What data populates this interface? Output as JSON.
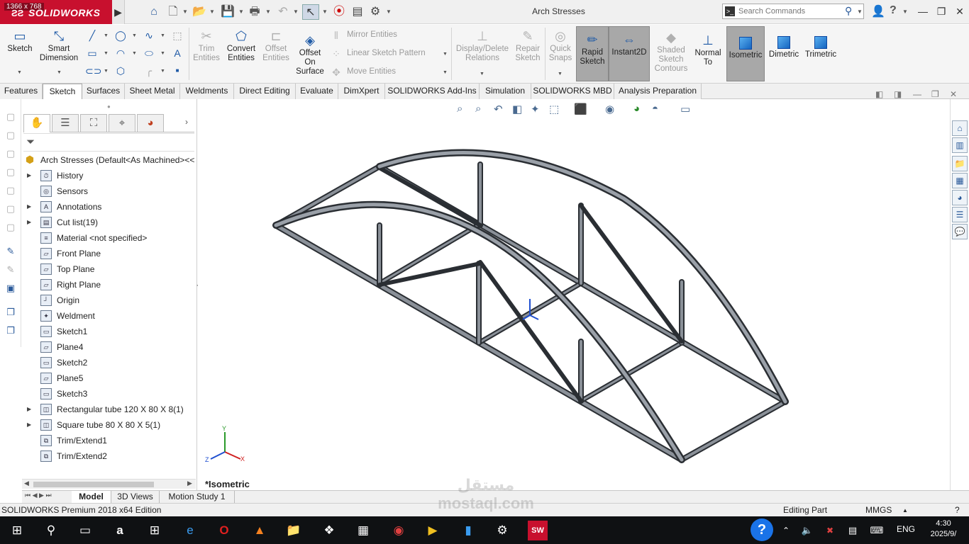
{
  "window": {
    "resolution_badge": "1366 x 768",
    "brand": "SOLIDWORKS",
    "title": "Arch Stresses",
    "search_placeholder": "Search Commands"
  },
  "ribbon": {
    "sketch": "Sketch",
    "smart_dimension": "Smart Dimension",
    "trim_entities": "Trim Entities",
    "convert_entities": "Convert Entities",
    "offset_entities": "Offset Entities",
    "offset_on_surface": "Offset On Surface",
    "mirror_entities": "Mirror Entities",
    "linear_sketch_pattern": "Linear Sketch Pattern",
    "move_entities": "Move Entities",
    "display_delete_relations": "Display/Delete Relations",
    "repair_sketch": "Repair Sketch",
    "quick_snaps": "Quick Snaps",
    "rapid_sketch": "Rapid Sketch",
    "instant2d": "Instant2D",
    "shaded_sketch_contours": "Shaded Sketch Contours",
    "normal_to": "Normal To",
    "isometric": "Isometric",
    "dimetric": "Dimetric",
    "trimetric": "Trimetric"
  },
  "tabs": [
    "Features",
    "Sketch",
    "Surfaces",
    "Sheet Metal",
    "Weldments",
    "Direct Editing",
    "Evaluate",
    "DimXpert",
    "SOLIDWORKS Add-Ins",
    "Simulation",
    "SOLIDWORKS MBD",
    "Analysis Preparation"
  ],
  "feature_tree": {
    "root": "Arch Stresses  (Default<As Machined><<",
    "items": [
      {
        "label": "History",
        "expandable": true,
        "icon": "history-icon"
      },
      {
        "label": "Sensors",
        "expandable": false,
        "icon": "sensor-icon"
      },
      {
        "label": "Annotations",
        "expandable": true,
        "icon": "annotation-icon"
      },
      {
        "label": "Cut list(19)",
        "expandable": true,
        "icon": "cutlist-icon"
      },
      {
        "label": "Material <not specified>",
        "expandable": false,
        "icon": "material-icon"
      },
      {
        "label": "Front Plane",
        "expandable": false,
        "icon": "plane-icon"
      },
      {
        "label": "Top Plane",
        "expandable": false,
        "icon": "plane-icon"
      },
      {
        "label": "Right Plane",
        "expandable": false,
        "icon": "plane-icon"
      },
      {
        "label": "Origin",
        "expandable": false,
        "icon": "origin-icon"
      },
      {
        "label": "Weldment",
        "expandable": false,
        "icon": "weldment-icon"
      },
      {
        "label": "Sketch1",
        "expandable": false,
        "icon": "sketch-icon"
      },
      {
        "label": "Plane4",
        "expandable": false,
        "icon": "plane-icon"
      },
      {
        "label": "Sketch2",
        "expandable": false,
        "icon": "sketch-icon"
      },
      {
        "label": "Plane5",
        "expandable": false,
        "icon": "plane-icon"
      },
      {
        "label": "Sketch3",
        "expandable": false,
        "icon": "sketch-icon"
      },
      {
        "label": "Rectangular tube 120 X 80 X 8(1)",
        "expandable": true,
        "icon": "structural-member-icon"
      },
      {
        "label": "Square tube 80 X 80 X 5(1)",
        "expandable": true,
        "icon": "structural-member-icon"
      },
      {
        "label": "Trim/Extend1",
        "expandable": false,
        "icon": "trim-extend-icon"
      },
      {
        "label": "Trim/Extend2",
        "expandable": false,
        "icon": "trim-extend-icon"
      }
    ]
  },
  "viewport": {
    "view_label": "*Isometric",
    "triad": {
      "x": "X",
      "y": "Y",
      "z": "Z"
    }
  },
  "model_tabs": [
    "Model",
    "3D Views",
    "Motion Study 1"
  ],
  "status": {
    "edition": "SOLIDWORKS Premium 2018 x64 Edition",
    "mode": "Editing Part",
    "units": "MMGS"
  },
  "taskbar": {
    "lang": "ENG",
    "time": "4:30",
    "date": "2025/9/"
  },
  "watermark": "مستقل mostaql.com"
}
